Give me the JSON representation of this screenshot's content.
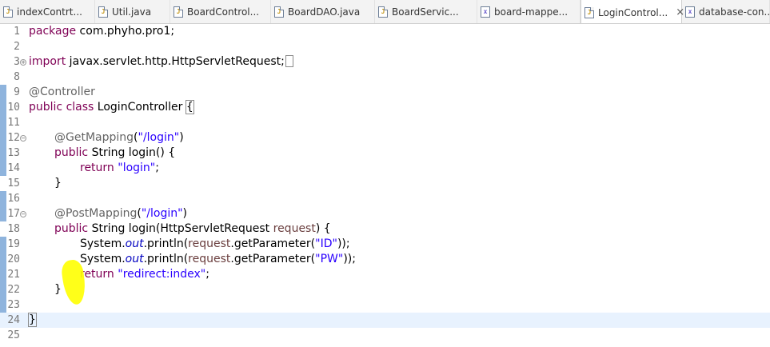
{
  "tabs": [
    {
      "label": "indexContrt...",
      "icon": "java-file-icon",
      "active": false
    },
    {
      "label": "Util.java",
      "icon": "java-file-icon",
      "active": false
    },
    {
      "label": "BoardControl...",
      "icon": "java-file-icon",
      "active": false
    },
    {
      "label": "BoardDAO.java",
      "icon": "java-file-icon",
      "active": false
    },
    {
      "label": "BoardServic...",
      "icon": "java-file-icon",
      "active": false
    },
    {
      "label": "board-mappe...",
      "icon": "xml-file-icon",
      "active": false
    },
    {
      "label": "LoginControl...",
      "icon": "java-file-icon",
      "active": true,
      "close": "×"
    },
    {
      "label": "database-con...",
      "icon": "xml-file-icon",
      "active": false
    }
  ],
  "editor": {
    "lines": [
      {
        "num": "1",
        "tokens": [
          {
            "t": "package",
            "c": "kw"
          },
          {
            "t": " com.phyho.pro1;"
          }
        ]
      },
      {
        "num": "2",
        "tokens": []
      },
      {
        "num": "3",
        "fold": "expand",
        "tokens": [
          {
            "t": "import",
            "c": "kw"
          },
          {
            "t": " javax.servlet.http.HttpServletRequest;"
          }
        ]
      },
      {
        "num": "8",
        "tokens": []
      },
      {
        "num": "9",
        "tokens": [
          {
            "t": "@Controller",
            "c": "ann"
          }
        ]
      },
      {
        "num": "10",
        "tokens": [
          {
            "t": "public",
            "c": "kw"
          },
          {
            "t": " "
          },
          {
            "t": "class",
            "c": "kw"
          },
          {
            "t": " LoginController "
          },
          {
            "t": "{",
            "c": "bracket"
          }
        ]
      },
      {
        "num": "11",
        "tokens": []
      },
      {
        "num": "12",
        "fold": "collapse",
        "indent": 1,
        "tokens": [
          {
            "t": "@GetMapping",
            "c": "ann"
          },
          {
            "t": "("
          },
          {
            "t": "\"/login\"",
            "c": "str"
          },
          {
            "t": ")"
          }
        ]
      },
      {
        "num": "13",
        "indent": 1,
        "tokens": [
          {
            "t": "public",
            "c": "kw"
          },
          {
            "t": " String login() {"
          }
        ]
      },
      {
        "num": "14",
        "indent": 2,
        "tokens": [
          {
            "t": "return",
            "c": "kw"
          },
          {
            "t": " "
          },
          {
            "t": "\"login\"",
            "c": "str"
          },
          {
            "t": ";"
          }
        ]
      },
      {
        "num": "15",
        "indent": 1,
        "tokens": [
          {
            "t": "}"
          }
        ]
      },
      {
        "num": "16",
        "tokens": []
      },
      {
        "num": "17",
        "fold": "collapse",
        "indent": 1,
        "tokens": [
          {
            "t": "@PostMapping",
            "c": "ann"
          },
          {
            "t": "("
          },
          {
            "t": "\"/login\"",
            "c": "str"
          },
          {
            "t": ")"
          }
        ]
      },
      {
        "num": "18",
        "indent": 1,
        "tokens": [
          {
            "t": "public",
            "c": "kw"
          },
          {
            "t": " String login(HttpServletRequest "
          },
          {
            "t": "request",
            "c": "var"
          },
          {
            "t": ") {"
          }
        ]
      },
      {
        "num": "19",
        "indent": 2,
        "tokens": [
          {
            "t": "System."
          },
          {
            "t": "out",
            "c": "fld"
          },
          {
            "t": ".println("
          },
          {
            "t": "request",
            "c": "var"
          },
          {
            "t": ".getParameter("
          },
          {
            "t": "\"ID\"",
            "c": "str"
          },
          {
            "t": "));"
          }
        ]
      },
      {
        "num": "20",
        "indent": 2,
        "tokens": [
          {
            "t": "System."
          },
          {
            "t": "out",
            "c": "fld"
          },
          {
            "t": ".println("
          },
          {
            "t": "request",
            "c": "var"
          },
          {
            "t": ".getParameter("
          },
          {
            "t": "\"PW\"",
            "c": "str"
          },
          {
            "t": "));"
          }
        ]
      },
      {
        "num": "21",
        "indent": 2,
        "tokens": [
          {
            "t": "return",
            "c": "kw"
          },
          {
            "t": " "
          },
          {
            "t": "\"redirect:index\"",
            "c": "str"
          },
          {
            "t": ";"
          }
        ]
      },
      {
        "num": "22",
        "indent": 1,
        "tokens": [
          {
            "t": "}"
          }
        ]
      },
      {
        "num": "23",
        "tokens": []
      },
      {
        "num": "24",
        "current": true,
        "tokens": [
          {
            "t": "}",
            "c": "bracket"
          },
          {
            "t": "",
            "c": "caret"
          }
        ]
      },
      {
        "num": "25",
        "tokens": []
      }
    ]
  },
  "colors": {
    "keyword": "#7f0055",
    "string": "#2a00ff",
    "annotation": "#646464",
    "field": "#0000c0",
    "variable": "#6a3e3e",
    "current_line": "#e8f2fe",
    "highlighter": "#ffff00"
  }
}
